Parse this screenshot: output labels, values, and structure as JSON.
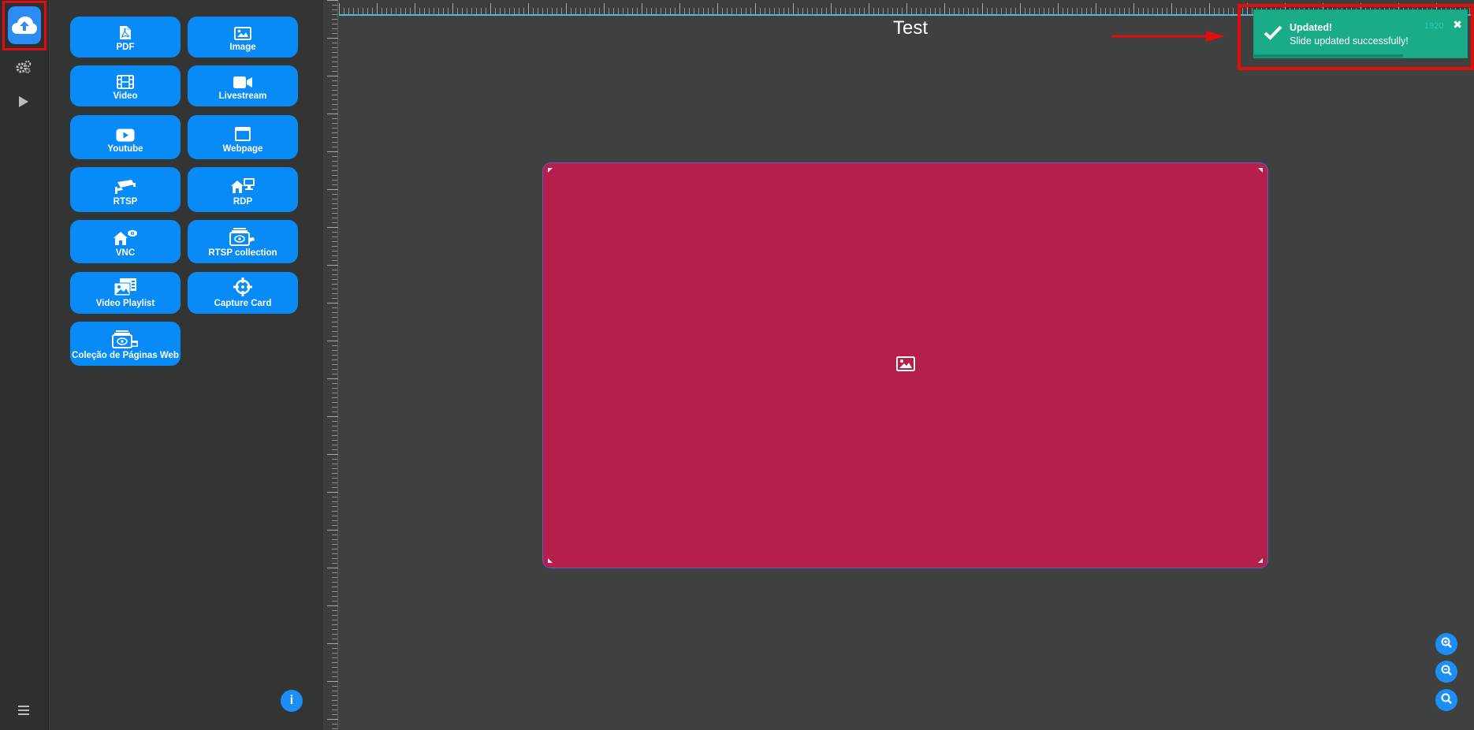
{
  "rail": {
    "upload_icon": "cloud-upload-icon",
    "settings_icon": "gears-icon",
    "play_icon": "play-icon",
    "menu_icon": "hamburger-icon"
  },
  "panel": {
    "tiles": [
      {
        "label": "PDF",
        "icon": "pdf-file-icon"
      },
      {
        "label": "Image",
        "icon": "image-icon"
      },
      {
        "label": "Video",
        "icon": "film-icon"
      },
      {
        "label": "Livestream",
        "icon": "video-camera-icon"
      },
      {
        "label": "Youtube",
        "icon": "youtube-icon"
      },
      {
        "label": "Webpage",
        "icon": "browser-window-icon"
      },
      {
        "label": "RTSP",
        "icon": "security-camera-icon"
      },
      {
        "label": "RDP",
        "icon": "remote-desktop-icon"
      },
      {
        "label": "VNC",
        "icon": "remote-view-icon"
      },
      {
        "label": "RTSP collection",
        "icon": "camera-collection-icon"
      },
      {
        "label": "Video Playlist",
        "icon": "video-playlist-icon"
      },
      {
        "label": "Capture Card",
        "icon": "crosshairs-icon"
      },
      {
        "label": "Coleção de Páginas Web",
        "icon": "webpage-collection-icon"
      }
    ],
    "info_label": "i"
  },
  "canvas": {
    "title": "Test",
    "slide_color": "#b51f4b",
    "slide_icon": "image-icon"
  },
  "zoom": {
    "zoom_in_icon": "zoom-in-icon",
    "zoom_out_icon": "zoom-out-icon",
    "zoom_reset_icon": "search-icon"
  },
  "toast": {
    "title": "Updated!",
    "message": "Slide updated successfully!",
    "ghost_text": "1920",
    "close_label": "✖",
    "color": "#1aab87",
    "progress": 0.7
  },
  "colors": {
    "accent": "#098bf7",
    "highlight": "#e40d0d"
  }
}
